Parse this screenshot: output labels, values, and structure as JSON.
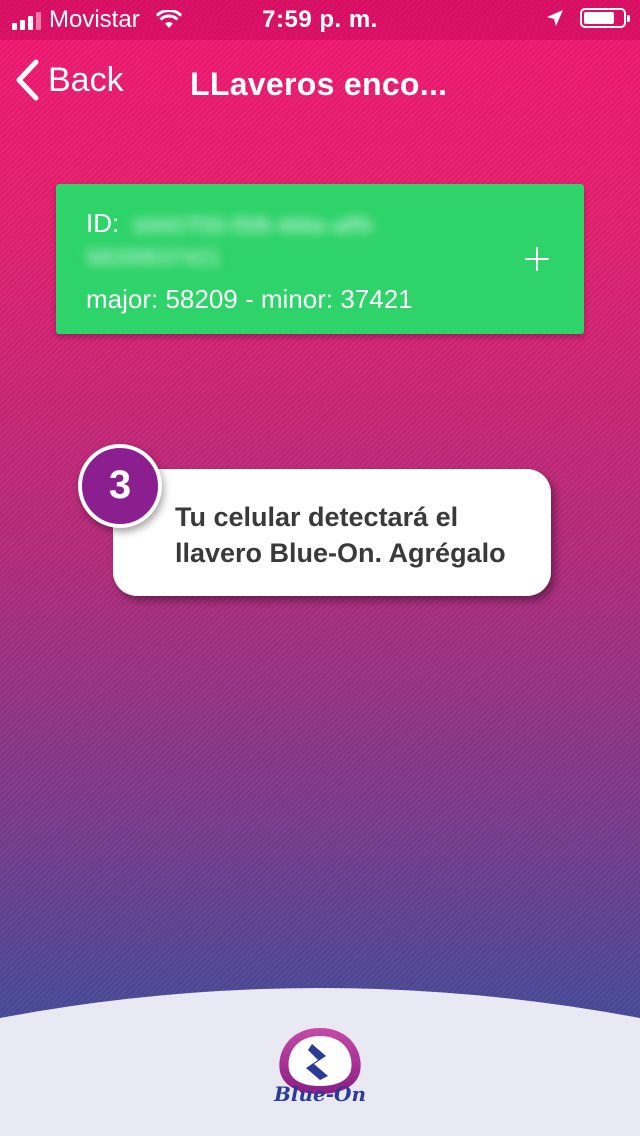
{
  "status_bar": {
    "carrier": "Movistar",
    "time": "7:59 p. m."
  },
  "nav": {
    "back_label": "Back",
    "title": "LLaveros enco..."
  },
  "beacon_card": {
    "id_label": "ID:",
    "id_value": "b9407f30-f5f8-466e-aff9-58209537421",
    "major_minor": "major: 58209 - minor: 37421",
    "color": "#2ed36a"
  },
  "tutorial": {
    "step": "3",
    "text": "Tu celular detectará el llavero Blue-On. Agrégalo"
  },
  "footer": {
    "logo_text": "Blue-On"
  },
  "colors": {
    "gradient_top": "#f21770",
    "gradient_bottom": "#3b4e99",
    "badge": "#8c1f8f",
    "brand_blue": "#2b3b97"
  }
}
